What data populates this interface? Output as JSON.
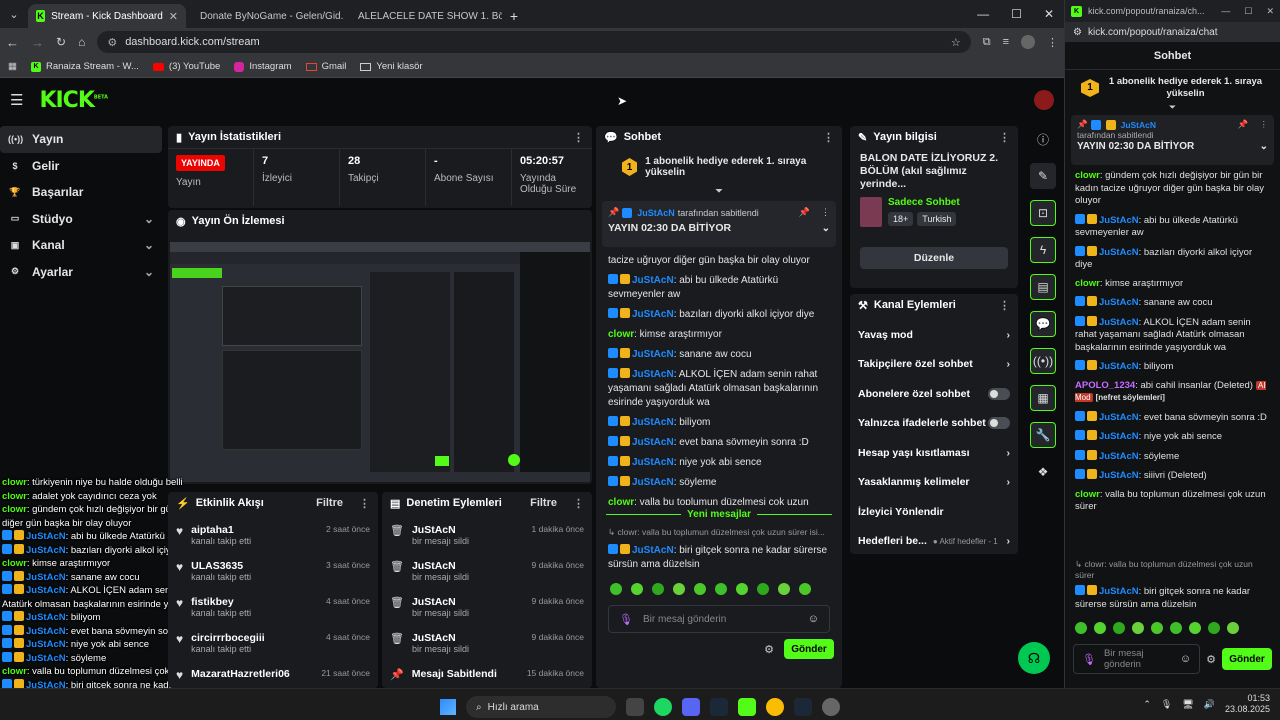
{
  "browser": {
    "tabs": [
      {
        "title": "Stream - Kick Dashboard",
        "active": true
      },
      {
        "title": "Donate ByNoGame - Gelen/Gid...",
        "active": false
      },
      {
        "title": "ALELACELE DATE SHOW 1. Bölü...",
        "active": false
      }
    ],
    "url": "dashboard.kick.com/stream",
    "bookmarks": [
      "Ranaiza Stream - W...",
      "(3) YouTube",
      "Instagram",
      "Gmail",
      "Yeni klasör"
    ]
  },
  "kick": {
    "logo": "KICK",
    "logo_sup": "BETA"
  },
  "sidebar": {
    "items": [
      {
        "label": "Yayın",
        "icon": "broadcast-icon",
        "selected": true,
        "chevron": false
      },
      {
        "label": "Gelir",
        "icon": "dollar-icon",
        "selected": false,
        "chevron": false
      },
      {
        "label": "Başarılar",
        "icon": "trophy-icon",
        "selected": false,
        "chevron": false
      },
      {
        "label": "Stüdyo",
        "icon": "studio-icon",
        "selected": false,
        "chevron": true
      },
      {
        "label": "Kanal",
        "icon": "channel-icon",
        "selected": false,
        "chevron": true
      },
      {
        "label": "Ayarlar",
        "icon": "gear-icon",
        "selected": false,
        "chevron": true
      }
    ]
  },
  "stats": {
    "title": "Yayın İstatistikleri",
    "live_badge": "YAYINDA",
    "live_label": "Yayın",
    "viewers": "7",
    "viewers_label": "İzleyici",
    "followers": "28",
    "followers_label": "Takipçi",
    "subs": "-",
    "subs_label": "Abone Sayısı",
    "uptime": "05:20:57",
    "uptime_label": "Yayında Olduğu Süre"
  },
  "preview": {
    "title": "Yayın Ön İzlemesi"
  },
  "activity": {
    "title": "Etkinlik Akışı",
    "filter": "Filtre",
    "items": [
      {
        "name": "aiptaha1",
        "desc": "kanalı takip etti",
        "time": "2 saat önce"
      },
      {
        "name": "ULAS3635",
        "desc": "kanalı takip etti",
        "time": "3 saat önce"
      },
      {
        "name": "fistikbey",
        "desc": "kanalı takip etti",
        "time": "4 saat önce"
      },
      {
        "name": "circirrrbocegiii",
        "desc": "kanalı takip etti",
        "time": "4 saat önce"
      },
      {
        "name": "MazaratHazretleri06",
        "desc": "",
        "time": "21 saat önce"
      }
    ]
  },
  "moderation": {
    "title": "Denetim Eylemleri",
    "filter": "Filtre",
    "items": [
      {
        "name": "JuStAcN",
        "desc": "bir mesajı sildi",
        "time": "1 dakika önce"
      },
      {
        "name": "JuStAcN",
        "desc": "bir mesajı sildi",
        "time": "9 dakika önce"
      },
      {
        "name": "JuStAcN",
        "desc": "bir mesajı sildi",
        "time": "9 dakika önce"
      },
      {
        "name": "JuStAcN",
        "desc": "bir mesajı sildi",
        "time": "9 dakika önce"
      },
      {
        "name": "Mesajı Sabitlendi",
        "desc": "",
        "time": "15 dakika önce"
      }
    ]
  },
  "chat": {
    "title": "Sohbet",
    "goal_num": "1",
    "goal_text": "1 abonelik hediye ederek 1. sıraya yükselin",
    "pinned_by": "JuStAcN",
    "pinned_suffix": "tarafından sabitlendi",
    "pinned_msg": "YAYIN 02:30 DA BİTİYOR",
    "messages": [
      {
        "user": "",
        "text": "tacize uğruyor diğer gün başka bir olay oluyor"
      },
      {
        "user": "JuStAcN",
        "text": ": abi bu ülkede Atatürkü sevmeyenler aw"
      },
      {
        "user": "JuStAcN",
        "text": ": bazıları diyorki alkol içiyor diye"
      },
      {
        "user": "clowr",
        "text": ": kimse araştırmıyor"
      },
      {
        "user": "JuStAcN",
        "text": ": sanane aw cocu"
      },
      {
        "user": "JuStAcN",
        "text": ": ALKOL İÇEN adam senin rahat yaşamanı sağladı Atatürk olmasan başkalarının esirinde yaşıyorduk wa"
      },
      {
        "user": "JuStAcN",
        "text": ": biliyom"
      },
      {
        "user": "JuStAcN",
        "text": ": evet bana sövmeyin sonra :D"
      },
      {
        "user": "JuStAcN",
        "text": ": niye yok abi sence"
      },
      {
        "user": "JuStAcN",
        "text": ": söyleme"
      },
      {
        "user": "clowr",
        "text": ": valla bu toplumun düzelmesi çok uzun sürer"
      }
    ],
    "new_messages": "Yeni mesajlar",
    "reply_preview": "↳ clowr: valla bu toplumun düzelmesi çok uzun sürer isi...",
    "last_user": "JuStAcN",
    "last_text": ": biri gitçek sonra ne kadar sürerse sürsün ama düzelsin",
    "input_placeholder": "Bir mesaj gönderin",
    "send": "Gönder"
  },
  "info": {
    "title": "Yayın bilgisi",
    "stream_title": "BALON DATE İZLİYORUZ 2. BÖLÜM (akıl sağlımız yerinde...",
    "category": "Sadece Sohbet",
    "tags": [
      "18+",
      "Turkish"
    ],
    "edit": "Düzenle"
  },
  "actions": {
    "title": "Kanal Eylemleri",
    "rows": [
      {
        "label": "Yavaş mod",
        "type": "chevron"
      },
      {
        "label": "Takipçilere özel sohbet",
        "type": "chevron"
      },
      {
        "label": "Abonelere özel sohbet",
        "type": "toggle"
      },
      {
        "label": "Yalnızca ifadelerle sohbet",
        "type": "toggle"
      },
      {
        "label": "Hesap yaşı kısıtlaması",
        "type": "chevron"
      },
      {
        "label": "Yasaklanmış kelimeler",
        "type": "chevron"
      },
      {
        "label": "İzleyici Yönlendir",
        "type": "none"
      },
      {
        "label": "Hedefleri be...",
        "type": "chevron",
        "extra": "● Aktif hedefler - 1"
      }
    ]
  },
  "popout": {
    "url": "kick.com/popout/ranaiza/chat",
    "url_short": "kick.com/popout/ranaiza/chat",
    "tab_title": "kick.com/popout/ranaiza/ch...",
    "title": "Sohbet",
    "goal": "1 abonelik hediye ederek 1. sıraya yükselin",
    "pinned_by": "JuStAcN",
    "pinned_suffix": "tarafından sabitlendi",
    "pinned_msg": "YAYIN 02:30 DA BİTİYOR",
    "messages": [
      {
        "user": "clowr",
        "text": ": gündem çok hızlı değişiyor bir gün bir kadın tacize uğruyor diğer gün başka bir olay oluyor"
      },
      {
        "user": "JuStAcN",
        "text": ": abi bu ülkede Atatürkü sevmeyenler aw"
      },
      {
        "user": "JuStAcN",
        "text": ": bazıları diyorki alkol içiyor diye"
      },
      {
        "user": "clowr",
        "text": ": kimse araştırmıyor"
      },
      {
        "user": "JuStAcN",
        "text": ": sanane aw cocu"
      },
      {
        "user": "JuStAcN",
        "text": ": ALKOL İÇEN adam senin rahat yaşamanı sağladı Atatürk olmasan başkalarının esirinde yaşıyorduk wa"
      },
      {
        "user": "JuStAcN",
        "text": ": biliyom"
      },
      {
        "user": "APOLO_1234",
        "text": ": abi cahil insanlar (Deleted)",
        "tag": "AI Mod",
        "tag2": "[nefret söylemleri]"
      },
      {
        "user": "JuStAcN",
        "text": ": evet bana sövmeyin sonra :D"
      },
      {
        "user": "JuStAcN",
        "text": ": niye yok abi sence"
      },
      {
        "user": "JuStAcN",
        "text": ": söyleme"
      },
      {
        "user": "JuStAcN",
        "text": ": siiivri (Deleted)"
      },
      {
        "user": "clowr",
        "text": ": valla bu toplumun düzelmesi çok uzun sürer"
      }
    ],
    "reply": "↳ clowr: valla bu toplumun düzelmesi çok uzun sürer",
    "last_user": "JuStAcN",
    "last_text": ": biri gitçek sonra ne kadar sürerse sürsün ama düzelsin",
    "input_placeholder": "Bir mesaj gönderin",
    "send": "Gönder"
  },
  "overlay": {
    "lines": [
      {
        "user": "clowr",
        "text": ": türkiyenin niye bu halde olduğu belli"
      },
      {
        "user": "clowr",
        "text": ": adalet yok cayıdırıcı ceza yok"
      },
      {
        "user": "clowr",
        "text": ": gündem çok hızlı değişiyor bir gün bir kadın tacize uğruyor diğer gün başka bir olay oluyor"
      },
      {
        "user": "JuStAcN",
        "text": ": abi bu ülkede Atatürkü sevmeyenler aw"
      },
      {
        "user": "JuStAcN",
        "text": ": bazıları diyorki alkol içiyor diye"
      },
      {
        "user": "clowr",
        "text": ": kimse araştırmıyor"
      },
      {
        "user": "JuStAcN",
        "text": ": sanane aw cocu"
      },
      {
        "user": "JuStAcN",
        "text": ": ALKOL İÇEN adam senin rahat yaşamanı sağladı Atatürk olmasan başkalarının esirinde yaşıyorduk wa"
      },
      {
        "user": "JuStAcN",
        "text": ": biliyom"
      },
      {
        "user": "JuStAcN",
        "text": ": evet bana sövmeyin sonra :D"
      },
      {
        "user": "JuStAcN",
        "text": ": niye yok abi sence"
      },
      {
        "user": "JuStAcN",
        "text": ": söyleme"
      },
      {
        "user": "clowr",
        "text": ": valla bu toplumun düzelmesi çok uzun sürer"
      },
      {
        "user": "JuStAcN",
        "text": ": biri gitçek sonra ne kadar sürerse sürsün ama düzelsin"
      }
    ]
  },
  "taskbar": {
    "search": "Hızlı arama",
    "time": "01:53",
    "date": "23.08.2025"
  },
  "colors": {
    "accent": "#53fc18",
    "live": "#eb0400",
    "bg": "#0b0c0e",
    "panel": "#191b1f"
  }
}
